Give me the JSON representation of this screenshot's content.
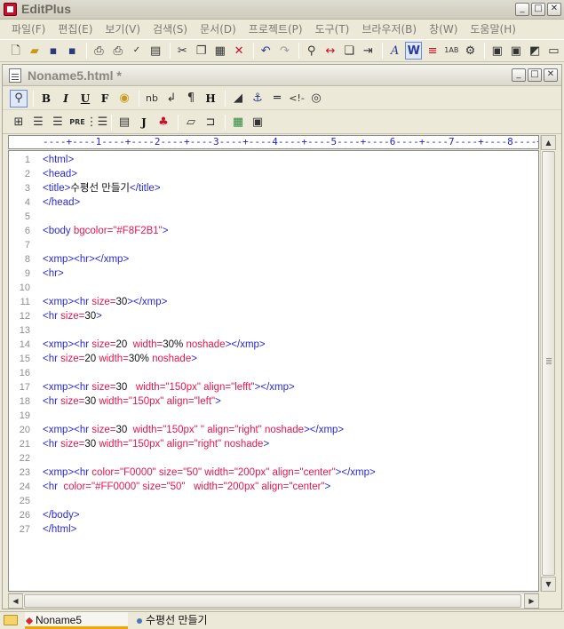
{
  "window": {
    "title": "EditPlus"
  },
  "menu": [
    "파일(F)",
    "편집(E)",
    "보기(V)",
    "검색(S)",
    "문서(D)",
    "프로젝트(P)",
    "도구(T)",
    "브라우저(B)",
    "창(W)",
    "도움말(H)"
  ],
  "document": {
    "title": "Noname5.html",
    "modified_marker": "*"
  },
  "ruler": "----+----1----+----2----+----3----+----4----+----5----+----6----+----7----+----8----+----9----+",
  "code_lines": [
    {
      "n": "1",
      "segs": [
        [
          "tag",
          "<html>"
        ]
      ]
    },
    {
      "n": "2",
      "segs": [
        [
          "tag",
          "<head>"
        ]
      ]
    },
    {
      "n": "3",
      "segs": [
        [
          "tag",
          "<title>"
        ],
        [
          "plain",
          "수평선 만들기"
        ],
        [
          "tag",
          "</title>"
        ]
      ]
    },
    {
      "n": "4",
      "segs": [
        [
          "tag",
          "</head>"
        ]
      ]
    },
    {
      "n": "5",
      "segs": []
    },
    {
      "n": "6",
      "segs": [
        [
          "tag",
          "<body "
        ],
        [
          "attr",
          "bgcolor="
        ],
        [
          "str",
          "\"#F8F2B1\""
        ],
        [
          "tag",
          ">"
        ]
      ]
    },
    {
      "n": "7",
      "segs": []
    },
    {
      "n": "8",
      "segs": [
        [
          "tag",
          "<xmp><hr></xmp>"
        ]
      ]
    },
    {
      "n": "9",
      "segs": [
        [
          "tag",
          "<hr>"
        ]
      ]
    },
    {
      "n": "10",
      "segs": []
    },
    {
      "n": "11",
      "segs": [
        [
          "tag",
          "<xmp><hr "
        ],
        [
          "attr",
          "size="
        ],
        [
          "plain",
          "30"
        ],
        [
          "tag",
          "></xmp>"
        ]
      ]
    },
    {
      "n": "12",
      "segs": [
        [
          "tag",
          "<hr "
        ],
        [
          "attr",
          "size="
        ],
        [
          "plain",
          "30"
        ],
        [
          "tag",
          ">"
        ]
      ]
    },
    {
      "n": "13",
      "segs": []
    },
    {
      "n": "14",
      "segs": [
        [
          "tag",
          "<xmp><hr "
        ],
        [
          "attr",
          "size="
        ],
        [
          "plain",
          "20  "
        ],
        [
          "attr",
          "width="
        ],
        [
          "plain",
          "30% "
        ],
        [
          "attr",
          "noshade"
        ],
        [
          "tag",
          "></xmp>"
        ]
      ]
    },
    {
      "n": "15",
      "segs": [
        [
          "tag",
          "<hr "
        ],
        [
          "attr",
          "size="
        ],
        [
          "plain",
          "20 "
        ],
        [
          "attr",
          "width="
        ],
        [
          "plain",
          "30% "
        ],
        [
          "attr",
          "noshade"
        ],
        [
          "tag",
          ">"
        ]
      ]
    },
    {
      "n": "16",
      "segs": []
    },
    {
      "n": "17",
      "segs": [
        [
          "tag",
          "<xmp><hr "
        ],
        [
          "attr",
          "size="
        ],
        [
          "plain",
          "30   "
        ],
        [
          "attr",
          "width="
        ],
        [
          "str",
          "\"150px\" "
        ],
        [
          "attr",
          "align="
        ],
        [
          "str",
          "\"lefft\""
        ],
        [
          "tag",
          "></xmp>"
        ]
      ]
    },
    {
      "n": "18",
      "segs": [
        [
          "tag",
          "<hr "
        ],
        [
          "attr",
          "size="
        ],
        [
          "plain",
          "30 "
        ],
        [
          "attr",
          "width="
        ],
        [
          "str",
          "\"150px\" "
        ],
        [
          "attr",
          "align="
        ],
        [
          "str",
          "\"left\""
        ],
        [
          "tag",
          ">"
        ]
      ]
    },
    {
      "n": "19",
      "segs": []
    },
    {
      "n": "20",
      "segs": [
        [
          "tag",
          "<xmp><hr "
        ],
        [
          "attr",
          "size="
        ],
        [
          "plain",
          "30  "
        ],
        [
          "attr",
          "width="
        ],
        [
          "str",
          "\"150px\" \" "
        ],
        [
          "attr",
          "align="
        ],
        [
          "str",
          "\"right\" "
        ],
        [
          "attr",
          "noshade"
        ],
        [
          "tag",
          "></xmp>"
        ]
      ]
    },
    {
      "n": "21",
      "segs": [
        [
          "tag",
          "<hr "
        ],
        [
          "attr",
          "size="
        ],
        [
          "plain",
          "30 "
        ],
        [
          "attr",
          "width="
        ],
        [
          "str",
          "\"150px\" "
        ],
        [
          "attr",
          "align="
        ],
        [
          "str",
          "\"right\" "
        ],
        [
          "attr",
          "noshade"
        ],
        [
          "tag",
          ">"
        ]
      ]
    },
    {
      "n": "22",
      "segs": []
    },
    {
      "n": "23",
      "segs": [
        [
          "tag",
          "<xmp><hr "
        ],
        [
          "attr",
          "color="
        ],
        [
          "str",
          "\"F0000\" "
        ],
        [
          "attr",
          "size="
        ],
        [
          "str",
          "\"50\" "
        ],
        [
          "attr",
          "width="
        ],
        [
          "str",
          "\"200px\" "
        ],
        [
          "attr",
          "align="
        ],
        [
          "str",
          "\"center\""
        ],
        [
          "tag",
          "></xmp>"
        ]
      ]
    },
    {
      "n": "24",
      "segs": [
        [
          "tag",
          "<hr  "
        ],
        [
          "attr",
          "color="
        ],
        [
          "str",
          "\"#FF0000\" "
        ],
        [
          "attr",
          "size="
        ],
        [
          "str",
          "\"50\"   "
        ],
        [
          "attr",
          "width="
        ],
        [
          "str",
          "\"200px\" "
        ],
        [
          "attr",
          "align="
        ],
        [
          "str",
          "\"center\""
        ],
        [
          "tag",
          ">"
        ]
      ]
    },
    {
      "n": "25",
      "segs": []
    },
    {
      "n": "26",
      "segs": [
        [
          "tag",
          "</body>"
        ]
      ]
    },
    {
      "n": "27",
      "segs": [
        [
          "tag",
          "</html>"
        ]
      ]
    }
  ],
  "tabs": [
    {
      "label": "Noname5",
      "active": true
    },
    {
      "label": "수평선 만들기",
      "active": false
    }
  ],
  "colors": {
    "tag": "#2a2ad0",
    "attr": "#e0164e",
    "tab_accent": "#f2a400"
  },
  "icons": {
    "main_toolbar": [
      "new-file-icon",
      "open-folder-icon",
      "save-icon",
      "save-all-icon",
      "print-preview-icon",
      "print-icon",
      "spellcheck-icon",
      "clipboard-history-icon",
      "cut-icon",
      "copy-icon",
      "paste-icon",
      "delete-icon",
      "undo-icon",
      "redo-icon",
      "find-icon",
      "replace-icon",
      "copy-file-icon",
      "indent-icon",
      "font-icon",
      "word-wrap-icon",
      "line-icon",
      "ruler-icon",
      "settings-icon",
      "view-icon",
      "page-icon",
      "window-icon",
      "monitor-icon"
    ],
    "html_toolbar1": [
      "quick-view-icon",
      "bold-icon",
      "italic-icon",
      "underline-icon",
      "font-tag-icon",
      "color-picker-icon",
      "nbsp-icon",
      "break-icon",
      "paragraph-icon",
      "heading-icon",
      "anchor-icon",
      "link-icon",
      "hr-icon",
      "comment-icon",
      "image-icon"
    ],
    "html_toolbar2": [
      "table-icon",
      "center-icon",
      "align-icon",
      "pre-icon",
      "list-icon",
      "script-icon",
      "java-icon",
      "plugin-icon",
      "frame-icon",
      "cursor-icon",
      "color-icon",
      "form-icon"
    ]
  }
}
